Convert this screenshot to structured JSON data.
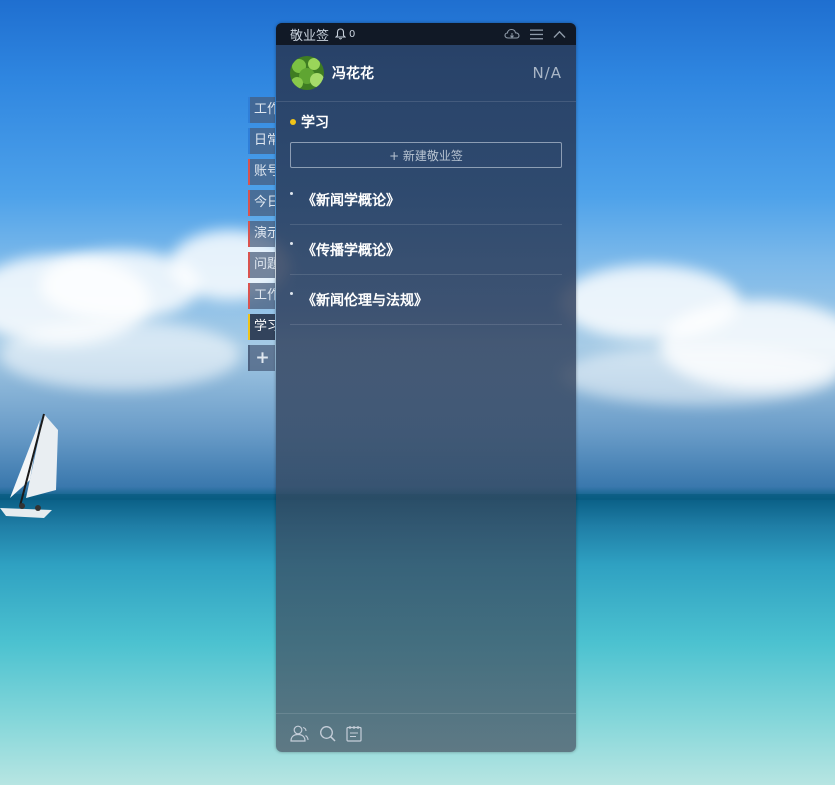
{
  "titlebar": {
    "app_name": "敬业签",
    "notification_count": "0",
    "icons": [
      "bell-icon",
      "cloud-sync-icon",
      "menu-icon",
      "collapse-icon"
    ]
  },
  "user": {
    "name": "冯花花",
    "status": "N/A"
  },
  "side_tabs": [
    {
      "label": "工作",
      "accent": "#2f7fd9"
    },
    {
      "label": "日常",
      "accent": "#2f7fd9"
    },
    {
      "label": "账号",
      "accent": "#d9534f"
    },
    {
      "label": "今日",
      "accent": "#d9534f"
    },
    {
      "label": "演示",
      "accent": "#d9534f"
    },
    {
      "label": "问题",
      "accent": "#d9534f"
    },
    {
      "label": "工作",
      "accent": "#d9534f"
    },
    {
      "label": "学习",
      "accent": "#f0c419",
      "active": true
    },
    {
      "label": "+",
      "type": "add"
    }
  ],
  "category": {
    "label": "学习",
    "dot_color": "#f0c419"
  },
  "new_note_button": "+ 新建敬业签",
  "notes": [
    {
      "title": "《新闻学概论》"
    },
    {
      "title": "《传播学概论》"
    },
    {
      "title": "《新闻伦理与法规》"
    }
  ],
  "bottom_bar": {
    "icons": [
      "contacts-icon",
      "search-icon",
      "notepad-icon"
    ]
  }
}
